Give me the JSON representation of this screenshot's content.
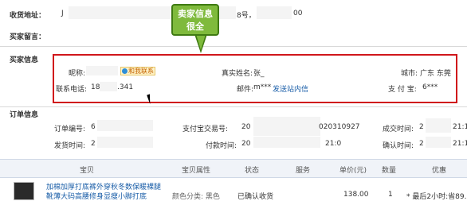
{
  "address": {
    "label": "收货地址：",
    "value_start": "J",
    "value_mid": "8号，",
    "value_end": "00"
  },
  "buyer_note": {
    "label": "买家留言："
  },
  "callout": {
    "text": "卖家信息很全"
  },
  "seller_info": {
    "label": "买家信息",
    "nickname_label": "昵称:",
    "contact_button": "和我联系",
    "realname_label": "真实姓名:",
    "realname_value": "张_",
    "city_label": "城市:",
    "city_value": "广东 东莞",
    "phone_label": "联系电话:",
    "phone_value_start": "18",
    "phone_value_end": ".341",
    "email_label": "邮件:",
    "email_value": "m***",
    "email_link": "发送站内信",
    "alipay_label": "支 付 宝:",
    "alipay_value": "6***"
  },
  "order_info": {
    "label": "订单信息",
    "order_no_label": "订单编号:",
    "order_no_value": "6",
    "alipay_trade_label": "支付宝交易号:",
    "alipay_trade_value_start": "20",
    "alipay_trade_value_end": "020310927",
    "accept_time_label": "成交时间:",
    "accept_time_value_start": "2",
    "accept_time_value_end": "21:1",
    "ship_time_label": "发货时间:",
    "ship_time_value": "2",
    "pay_time_label": "付款时间:",
    "pay_time_value_start": "20",
    "pay_time_value_end": "21:0",
    "confirm_time_label": "确认时间:",
    "confirm_time_value": "2",
    "confirm_time_value_end": "21:1"
  },
  "table": {
    "headers": [
      "宝贝",
      "宝贝属性",
      "状态",
      "服务",
      "单价(元)",
      "数量",
      "优惠"
    ],
    "row": {
      "title_line1": "加棉加厚打底裤外穿秋冬数保暖裸腿",
      "title_line2": "靴薄大码高腰修身显瘦小脚打底",
      "attr": "颜色分类: 黑色",
      "status": "已确认收货",
      "price": "138.00",
      "qty": "1",
      "discount": "* 最后2小时:省89.0"
    }
  }
}
